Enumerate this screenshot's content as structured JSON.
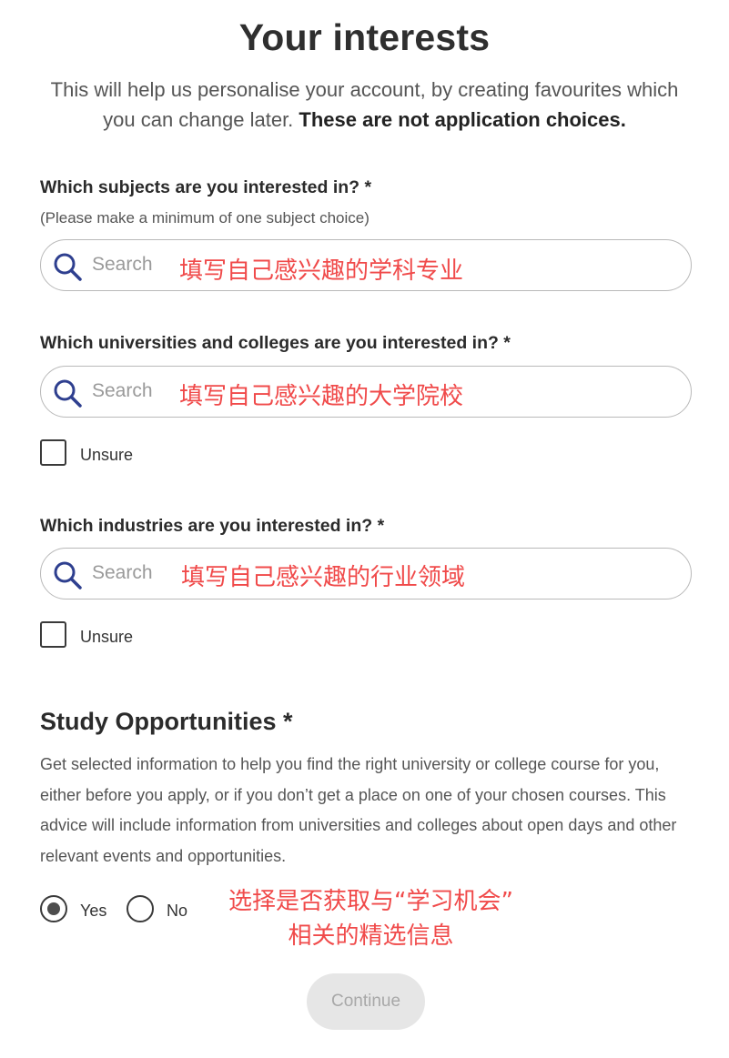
{
  "header": {
    "title": "Your interests",
    "intro_plain": "This will help us personalise your account, by creating favourites which you can change later.",
    "intro_bold": "These are not application choices."
  },
  "subjects": {
    "label": "Which subjects are you interested in? *",
    "hint": "(Please make a minimum of one subject choice)",
    "placeholder": "Search",
    "annotation": "填写自己感兴趣的学科专业"
  },
  "universities": {
    "label": "Which universities and colleges are you interested in? *",
    "placeholder": "Search",
    "annotation": "填写自己感兴趣的大学院校",
    "unsure_label": "Unsure"
  },
  "industries": {
    "label": "Which industries are you interested in? *",
    "placeholder": "Search",
    "annotation": "填写自己感兴趣的行业领域",
    "unsure_label": "Unsure"
  },
  "study_opportunities": {
    "title": "Study Opportunities *",
    "description": "Get selected information to help you find the right university or college course for you, either before you apply, or if you don’t get a place on one of your chosen courses. This advice will include information from universities and colleges about open days and other relevant events and opportunities.",
    "options": [
      {
        "label": "Yes",
        "selected": true
      },
      {
        "label": "No",
        "selected": false
      }
    ],
    "annotation_line1": "选择是否获取与“学习机会”",
    "annotation_line2": "相关的精选信息"
  },
  "actions": {
    "continue_label": "Continue"
  },
  "colors": {
    "annotation": "#f04a4a",
    "search_icon": "#2e3f8f",
    "button_bg": "#e6e6e6"
  }
}
